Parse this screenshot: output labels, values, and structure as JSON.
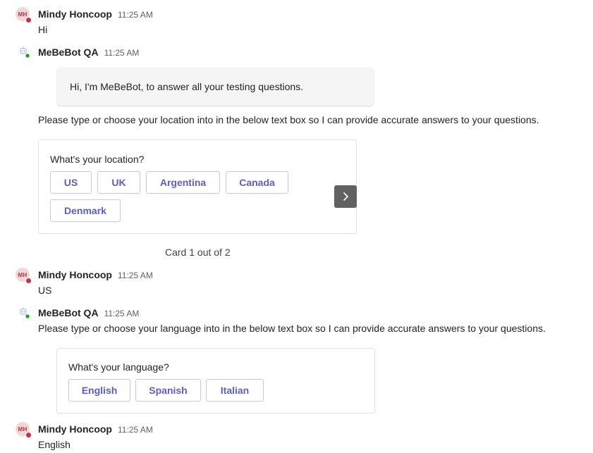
{
  "messages": [
    {
      "sender": "Mindy Honcoop",
      "initials": "MH",
      "time": "11:25 AM",
      "text": "Hi"
    },
    {
      "sender": "MeBeBot QA",
      "time": "11:25 AM",
      "bubble": "Hi, I'm MeBeBot, to answer all your testing questions.",
      "text": "Please type or choose your location into in the below text box so I can provide accurate answers to your questions."
    },
    {
      "sender": "Mindy Honcoop",
      "initials": "MH",
      "time": "11:25 AM",
      "text": "US"
    },
    {
      "sender": "MeBeBot QA",
      "time": "11:25 AM",
      "text": "Please type or choose your language into in the below text box so I can provide accurate answers to your questions."
    },
    {
      "sender": "Mindy Honcoop",
      "initials": "MH",
      "time": "11:25 AM",
      "text": "English"
    }
  ],
  "location_card": {
    "question": "What's your location?",
    "choices": [
      "US",
      "UK",
      "Argentina",
      "Canada",
      "Denmark"
    ],
    "counter": "Card 1 out of 2"
  },
  "language_card": {
    "question": "What's your language?",
    "choices": [
      "English",
      "Spanish",
      "Italian"
    ]
  },
  "icons": {
    "next": "chevron-right-icon",
    "bot": "bot-icon",
    "presence_user": "busy",
    "presence_bot": "available"
  },
  "colors": {
    "accent": "#5b5fc7",
    "busy": "#c4314b",
    "available": "#13a10e"
  }
}
